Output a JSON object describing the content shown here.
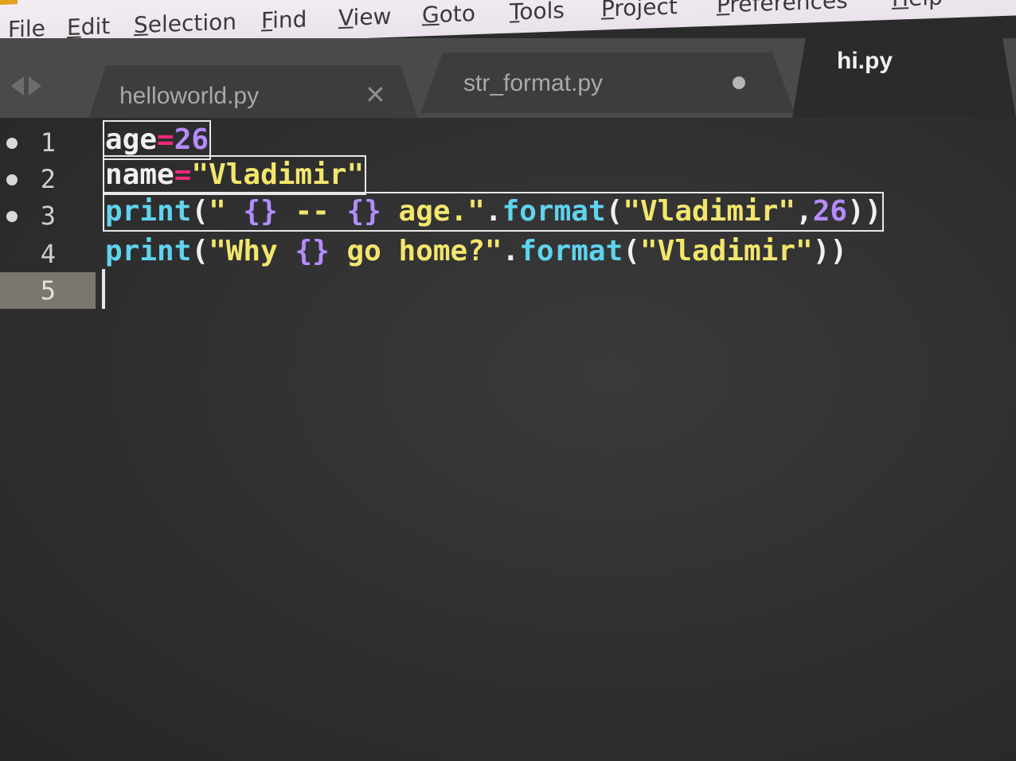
{
  "menu": [
    "File",
    "Edit",
    "Selection",
    "Find",
    "View",
    "Goto",
    "Tools",
    "Project",
    "Preferences",
    "Help"
  ],
  "tabs": [
    {
      "label": "helloworld.py",
      "state": "close"
    },
    {
      "label": "str_format.py",
      "state": "modified"
    },
    {
      "label": "hi.py",
      "state": "active"
    }
  ],
  "editor": {
    "line_numbers": [
      "1",
      "2",
      "3",
      "4",
      "5"
    ],
    "modified_lines": [
      1,
      2,
      3
    ],
    "current_line": 5,
    "lines": [
      [
        {
          "t": "age",
          "k": "var"
        },
        {
          "t": "=",
          "k": "op"
        },
        {
          "t": "26",
          "k": "num"
        }
      ],
      [
        {
          "t": "name",
          "k": "var"
        },
        {
          "t": "=",
          "k": "op"
        },
        {
          "t": "\"Vladimir\"",
          "k": "str"
        }
      ],
      [
        {
          "t": "print",
          "k": "fn"
        },
        {
          "t": "(",
          "k": "punct"
        },
        {
          "t": "\" ",
          "k": "str"
        },
        {
          "t": "{}",
          "k": "ph"
        },
        {
          "t": " -- ",
          "k": "str"
        },
        {
          "t": "{}",
          "k": "ph"
        },
        {
          "t": " age.\"",
          "k": "str"
        },
        {
          "t": ".",
          "k": "punct"
        },
        {
          "t": "format",
          "k": "fn"
        },
        {
          "t": "(",
          "k": "punct"
        },
        {
          "t": "\"Vladimir\"",
          "k": "str"
        },
        {
          "t": ",",
          "k": "punct"
        },
        {
          "t": "26",
          "k": "num"
        },
        {
          "t": "))",
          "k": "punct"
        }
      ],
      [
        {
          "t": "print",
          "k": "fn"
        },
        {
          "t": "(",
          "k": "punct"
        },
        {
          "t": "\"Why ",
          "k": "str"
        },
        {
          "t": "{}",
          "k": "ph"
        },
        {
          "t": " go home?\"",
          "k": "str"
        },
        {
          "t": ".",
          "k": "punct"
        },
        {
          "t": "format",
          "k": "fn"
        },
        {
          "t": "(",
          "k": "punct"
        },
        {
          "t": "\"Vladimir\"",
          "k": "str"
        },
        {
          "t": "))",
          "k": "punct"
        }
      ],
      []
    ]
  },
  "colors": {
    "background": "#2b2b2b",
    "keyword_operator": "#f0287a",
    "number": "#b48cff",
    "string": "#f3e66d",
    "function": "#5fd4ee"
  }
}
